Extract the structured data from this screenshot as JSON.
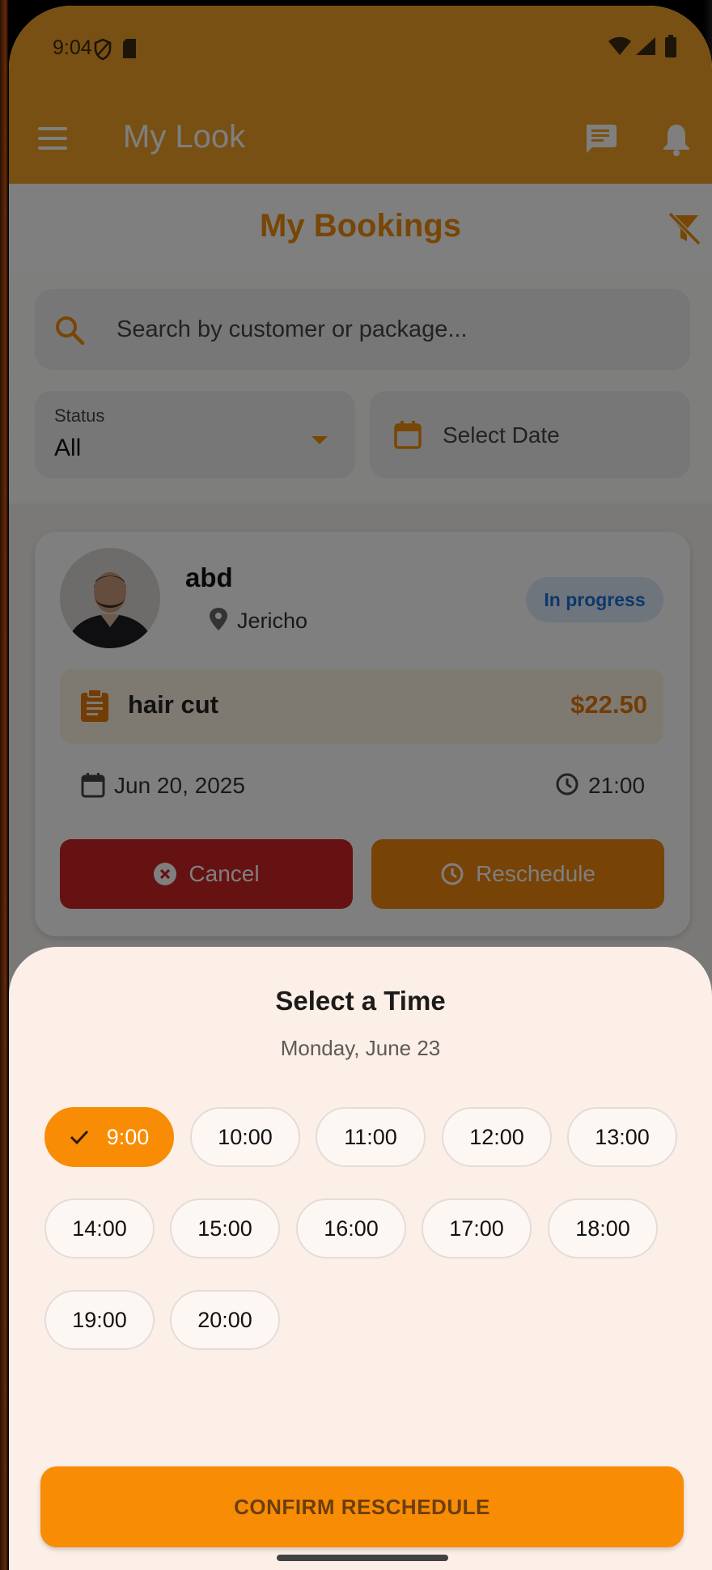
{
  "status_bar": {
    "time": "9:04"
  },
  "app_bar": {
    "title": "My Look"
  },
  "header": {
    "title": "My Bookings"
  },
  "search": {
    "placeholder": "Search by customer or package..."
  },
  "filters": {
    "status_label": "Status",
    "status_value": "All",
    "date_placeholder": "Select Date"
  },
  "booking": {
    "customer_name": "abd",
    "location": "Jericho",
    "status": "In progress",
    "package_name": "hair cut",
    "price": "$22.50",
    "date": "Jun 20, 2025",
    "time": "21:00",
    "cancel_label": "Cancel",
    "reschedule_label": "Reschedule"
  },
  "sheet": {
    "title": "Select a Time",
    "date": "Monday, June 23",
    "selected_slot": "9:00",
    "slots": [
      "9:00",
      "10:00",
      "11:00",
      "12:00",
      "13:00",
      "14:00",
      "15:00",
      "16:00",
      "17:00",
      "18:00",
      "19:00",
      "20:00"
    ],
    "confirm_label": "CONFIRM RESCHEDULE"
  },
  "colors": {
    "accent": "#f98c05",
    "app_bar": "#f1a127",
    "cancel": "#cc2424",
    "status_badge_text": "#1d6fd6"
  }
}
